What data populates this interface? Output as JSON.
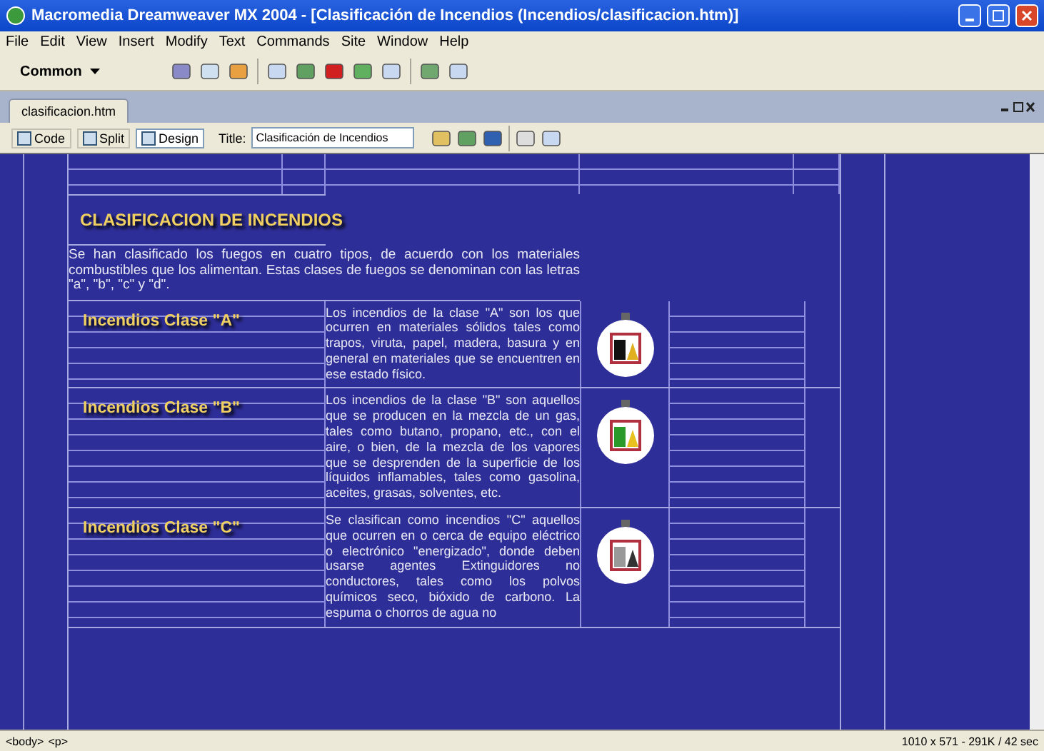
{
  "window": {
    "title": "Macromedia Dreamweaver MX 2004 - [Clasificación de Incendios (Incendios/clasificacion.htm)]"
  },
  "menu": [
    "File",
    "Edit",
    "View",
    "Insert",
    "Modify",
    "Text",
    "Commands",
    "Site",
    "Window",
    "Help"
  ],
  "insert_bar": {
    "category": "Common"
  },
  "document_tab": {
    "label": "clasificacion.htm",
    "selected": true
  },
  "view_buttons": [
    {
      "label": "Code",
      "selected": false
    },
    {
      "label": "Split",
      "selected": false
    },
    {
      "label": "Design",
      "selected": true
    }
  ],
  "title_field": {
    "label": "Title:",
    "value": "Clasificación de Incendios"
  },
  "page": {
    "heading": "CLASIFICACION DE INCENDIOS",
    "intro": "Se han clasificado los fuegos en cuatro tipos, de acuerdo con los materiales combustibles que los alimentan. Estas clases de fuegos se denominan con las letras \"a\", \"b\", \"c\" y \"d\".",
    "sections": [
      {
        "kind": "a",
        "heading": "Incendios Clase \"A\"",
        "body": "Los incendios de la clase \"A\" son los que ocurren en materiales sólidos tales como trapos, viruta, papel, madera, basura y en general en materiales que se encuentren en ese estado físico."
      },
      {
        "kind": "b",
        "heading": "Incendios Clase \"B\"",
        "body": "Los incendios de la clase \"B\" son aquellos que se producen en la mezcla de un gas, tales como butano, propano, etc., con el aire, o bien, de la mezcla de los vapores que se desprenden de la superficie de los líquidos inflamables, tales como gasolina, aceites, grasas, solventes, etc."
      },
      {
        "kind": "c",
        "heading": "Incendios Clase \"C\"",
        "body": "Se clasifican como incendios \"C\" aquellos que ocurren en o cerca de equipo eléctrico o electrónico \"energizado\", donde deben usarse agentes Extinguidores no conductores, tales como los polvos químicos seco, bióxido de carbono. La espuma o chorros de agua no"
      }
    ]
  },
  "status_bar": {
    "tags": [
      "<body>",
      "<p>"
    ],
    "info": "1010 x 571 - 291K / 42 sec"
  }
}
